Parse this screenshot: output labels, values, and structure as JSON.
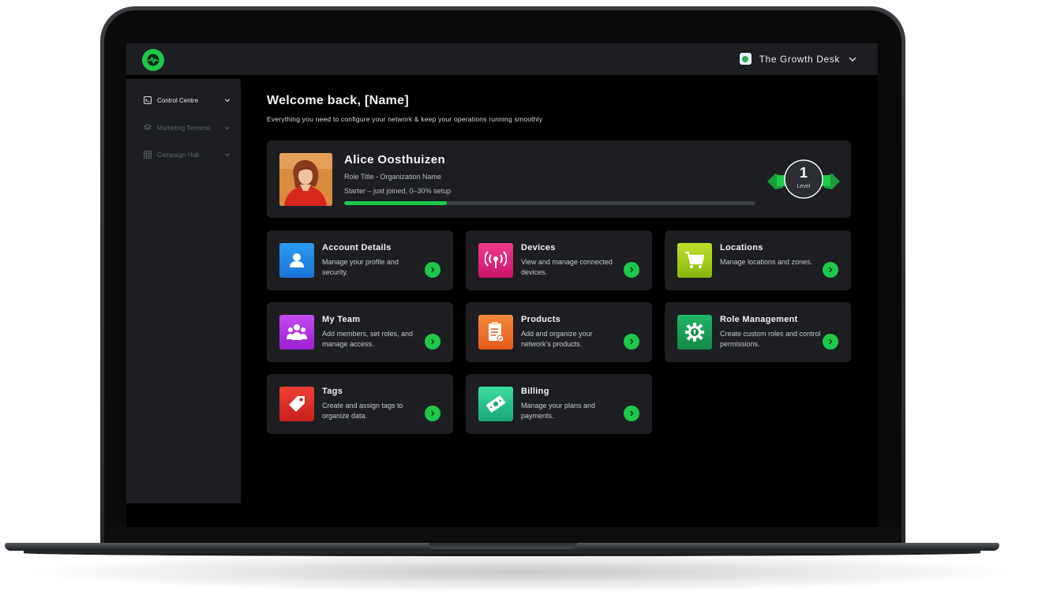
{
  "app": {
    "org_name": "The Growth Desk",
    "accent_color": "#1ec94a"
  },
  "sidebar": {
    "items": [
      {
        "label": "Control Centre",
        "icon": "terminal-icon",
        "active": true
      },
      {
        "label": "Marketing Terminal",
        "icon": "layers-icon",
        "active": false
      },
      {
        "label": "Campaign Hub",
        "icon": "grid-icon",
        "active": false
      }
    ]
  },
  "main": {
    "title": "Welcome back, [Name]",
    "subtitle": "Everything you need to configure your network & keep your operations running smoothly"
  },
  "profile": {
    "name": "Alice Oosthuizen",
    "role": "Role Title - Organization Name",
    "stage": "Starter – just joined, 0–30% setup",
    "progress": 0.25,
    "level_number": "1",
    "level_label": "Level"
  },
  "cards": [
    {
      "title": "Account Details",
      "description": "Manage your profile and security.",
      "icon": "user-icon",
      "color": "#1f8be8"
    },
    {
      "title": "Devices",
      "description": "View and manage connected devices.",
      "icon": "broadcast-icon",
      "color": "#e3247a"
    },
    {
      "title": "Locations",
      "description": "Manage locations and zones.",
      "icon": "cart-icon",
      "color": "#a8d218"
    },
    {
      "title": "My Team",
      "description": "Add members, set roles, and manage access.",
      "icon": "team-icon",
      "color": "#b12ee0"
    },
    {
      "title": "Products",
      "description": "Add and organize your network's products.",
      "icon": "clipboard-icon",
      "color": "#f0752a"
    },
    {
      "title": "Role Management",
      "description": "Create custom roles and control permissions.",
      "icon": "gear-lock-icon",
      "color": "#17a25a"
    },
    {
      "title": "Tags",
      "description": "Create and assign tags to organize data.",
      "icon": "tag-icon",
      "color": "#e5322d"
    },
    {
      "title": "Billing",
      "description": "Manage your plans and payments.",
      "icon": "money-icon",
      "color": "#27c98f"
    }
  ]
}
